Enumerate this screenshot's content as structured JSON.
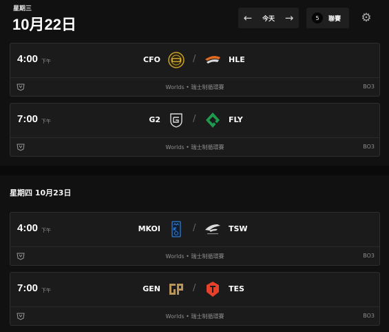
{
  "header": {
    "weekday": "星期三",
    "date": "10月22日",
    "today_label": "今天",
    "prev_icon": "arrow-left-icon",
    "next_icon": "arrow-right-icon",
    "league_count": "5",
    "leagues_label": "聯賽",
    "settings_icon": "gear-icon"
  },
  "day2": {
    "header": "星期四 10月23日"
  },
  "matches": [
    {
      "time": "4:00",
      "ampm": "下午",
      "team1": "CFO",
      "team2": "HLE",
      "league": "Worlds • 瑞士制循環賽",
      "bo": "BO3",
      "logo1_color": "#c9a227",
      "logo2_color": "#e06a1f"
    },
    {
      "time": "7:00",
      "ampm": "下午",
      "team1": "G2",
      "team2": "FLY",
      "league": "Worlds • 瑞士制循環賽",
      "bo": "BO3",
      "logo1_color": "#dcdcdc",
      "logo2_color": "#1f9a4c"
    },
    {
      "time": "4:00",
      "ampm": "下午",
      "team1": "MKOI",
      "team2": "TSW",
      "league": "Worlds • 瑞士制循環賽",
      "bo": "BO3",
      "logo1_color": "#2f7ad1",
      "logo2_color": "#dcdcdc"
    },
    {
      "time": "7:00",
      "ampm": "下午",
      "team1": "GEN",
      "team2": "TES",
      "league": "Worlds • 瑞士制循環賽",
      "bo": "BO3",
      "logo1_color": "#b8955a",
      "logo2_color": "#e5412b"
    }
  ]
}
